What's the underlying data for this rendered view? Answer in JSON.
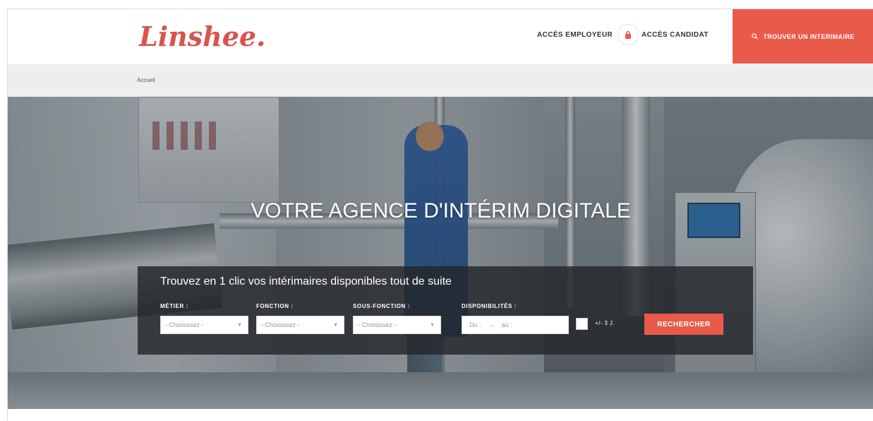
{
  "header": {
    "logo": "Linshee.",
    "nav_employer": "ACCÈS EMPLOYEUR",
    "lock_icon": "lock-icon",
    "nav_candidate": "ACCÈS CANDIDAT",
    "cta_label": "TROUVER UN INTERIMAIRE",
    "cta_icon": "search-icon",
    "accent_color": "#ea5a4b"
  },
  "breadcrumb": {
    "items": [
      "Accueil"
    ]
  },
  "hero": {
    "title": "VOTRE AGENCE D'INTÉRIM DIGITALE"
  },
  "search": {
    "title": "Trouvez en 1 clic vos intérimaires disponibles tout de suite",
    "metier_label": "MÉTIER :",
    "metier_value": "- Choisissez -",
    "fonction_label": "FONCTION :",
    "fonction_value": "- Choisissez -",
    "sous_fonction_label": "SOUS-FONCTION :",
    "sous_fonction_value": "- Choisissez -",
    "dispo_label": "DISPONIBILITÉS :",
    "date_from": "Du :",
    "date_arrow": "→",
    "date_to": "au :",
    "tolerance": "+/- 3 J.",
    "button": "RECHERCHER"
  }
}
